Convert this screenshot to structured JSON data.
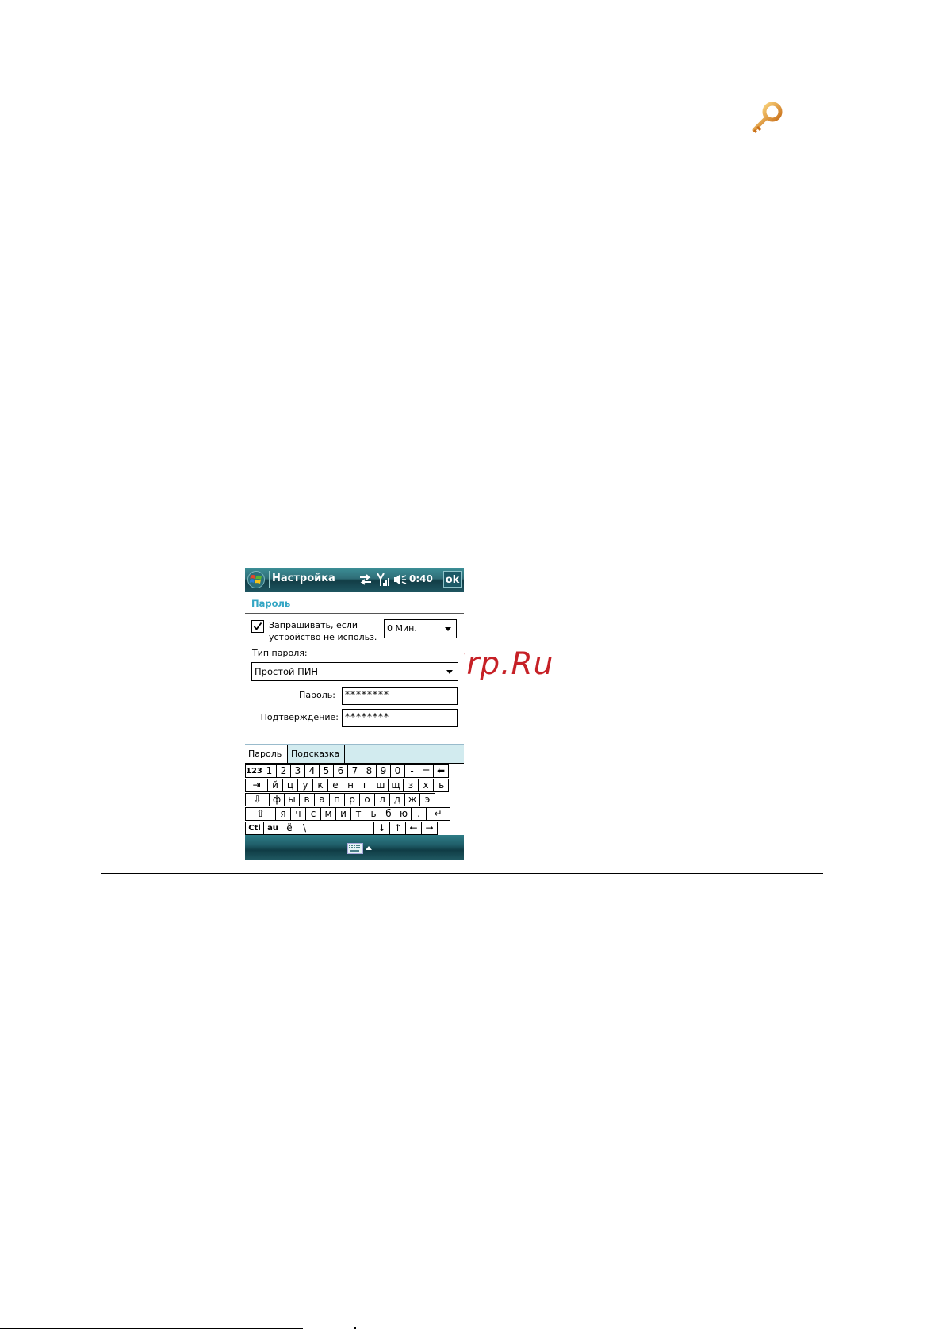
{
  "watermark": "McGrp.Ru",
  "phone": {
    "title": "Настройка",
    "time": "0:40",
    "ok_label": "ok",
    "section_heading": "Пароль",
    "lock_checkbox": {
      "checked": true,
      "label_line1": "Запрашивать, если",
      "label_line2": "устройство не использ."
    },
    "lock_timeout": "0 Мин.",
    "password_type_label": "Тип пароля:",
    "password_type_value": "Простой ПИН",
    "password_label": "Пароль:",
    "password_value": "********",
    "confirm_label": "Подтверждение:",
    "confirm_value": "********",
    "tabs": [
      "Пароль",
      "Подсказка"
    ],
    "keyboard": {
      "row1": [
        "123",
        "1",
        "2",
        "3",
        "4",
        "5",
        "6",
        "7",
        "8",
        "9",
        "0",
        "-",
        "=",
        "⬅"
      ],
      "row2": [
        "⇥",
        "й",
        "ц",
        "у",
        "к",
        "е",
        "н",
        "г",
        "ш",
        "щ",
        "з",
        "х",
        "ъ"
      ],
      "row3": [
        "⇩",
        "ф",
        "ы",
        "в",
        "а",
        "п",
        "р",
        "о",
        "л",
        "д",
        "ж",
        "э"
      ],
      "row4": [
        "⇧",
        "я",
        "ч",
        "с",
        "м",
        "и",
        "т",
        "ь",
        "б",
        "ю",
        ".",
        "↵"
      ],
      "row5": [
        "Ctl",
        "au",
        "ё",
        "\\",
        "",
        "↓",
        "↑",
        "←",
        "→"
      ]
    }
  },
  "icons": {
    "doc_icon": "key-icon",
    "start": "windows-start-icon",
    "sync": "sync-arrows-icon",
    "signal": "signal-strength-icon",
    "volume": "volume-muted-icon",
    "sip": "keyboard-icon"
  }
}
